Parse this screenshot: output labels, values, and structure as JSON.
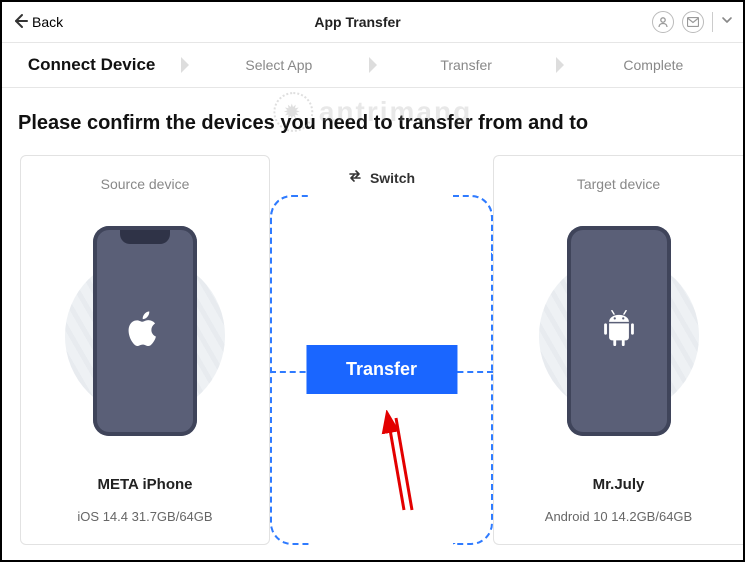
{
  "topbar": {
    "back_label": "Back",
    "app_title": "App Transfer"
  },
  "steps": {
    "s1": "Connect Device",
    "s2": "Select App",
    "s3": "Transfer",
    "s4": "Complete"
  },
  "heading": "Please confirm the devices you need to transfer from and to",
  "watermark_text": "antrimang",
  "switch_label": "Switch",
  "transfer_button": "Transfer",
  "source": {
    "title": "Source device",
    "name": "META iPhone",
    "info": "iOS 14.4 31.7GB/64GB",
    "platform": "apple"
  },
  "target": {
    "title": "Target device",
    "name": "Mr.July",
    "info": "Android 10 14.2GB/64GB",
    "platform": "android"
  }
}
